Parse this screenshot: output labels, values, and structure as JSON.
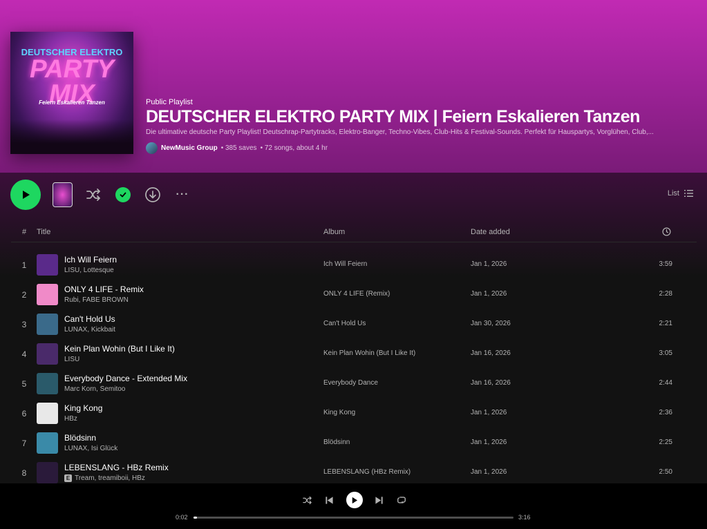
{
  "playlist": {
    "cover_line1": "DEUTSCHER",
    "cover_line1_accent": "ELEKTRO",
    "cover_line2": "PARTY MIX",
    "cover_line3": "Feiern Eskalieren Tanzen",
    "type_label": "Public Playlist",
    "title": "DEUTSCHER ELEKTRO PARTY MIX | Feiern Eskalieren Tanzen",
    "description": "Die ultimative deutsche Party Playlist! Deutschrap-Partytracks, Elektro-Banger, Techno-Vibes, Club-Hits & Festival-Sounds. Perfekt für Hauspartys, Vorglühen, Club,...",
    "owner": "NewMusic Group",
    "saves": "• 385 saves",
    "songs": "• 72 songs, about 4 hr"
  },
  "actions": {
    "view_label": "List",
    "more_label": "···"
  },
  "table": {
    "headers": {
      "num": "#",
      "title": "Title",
      "album": "Album",
      "date": "Date added"
    },
    "tracks": [
      {
        "num": "1",
        "title": "Ich Will Feiern",
        "artist": "LISU, Lottesque",
        "explicit": false,
        "album": "Ich Will Feiern",
        "date": "Jan 1, 2026",
        "duration": "3:59",
        "art_color": "#5a2a8a"
      },
      {
        "num": "2",
        "title": "ONLY 4 LIFE - Remix",
        "artist": "Rubi, FABE BROWN",
        "explicit": false,
        "album": "ONLY 4 LIFE (Remix)",
        "date": "Jan 1, 2026",
        "duration": "2:28",
        "art_color": "#f08ac8"
      },
      {
        "num": "3",
        "title": "Can't Hold Us",
        "artist": "LUNAX, Kickbait",
        "explicit": false,
        "album": "Can't Hold Us",
        "date": "Jan 30, 2026",
        "duration": "2:21",
        "art_color": "#3a6a8a"
      },
      {
        "num": "4",
        "title": "Kein Plan Wohin (But I Like It)",
        "artist": "LISU",
        "explicit": false,
        "album": "Kein Plan Wohin (But I Like It)",
        "date": "Jan 16, 2026",
        "duration": "3:05",
        "art_color": "#4a2a6a"
      },
      {
        "num": "5",
        "title": "Everybody Dance - Extended Mix",
        "artist": "Marc Korn, Semitoo",
        "explicit": false,
        "album": "Everybody Dance",
        "date": "Jan 16, 2026",
        "duration": "2:44",
        "art_color": "#2a5a6a"
      },
      {
        "num": "6",
        "title": "King Kong",
        "artist": "HBz",
        "explicit": false,
        "album": "King Kong",
        "date": "Jan 1, 2026",
        "duration": "2:36",
        "art_color": "#e8e8e8"
      },
      {
        "num": "7",
        "title": "Blödsinn",
        "artist": "LUNAX, Isi Glück",
        "explicit": false,
        "album": "Blödsinn",
        "date": "Jan 1, 2026",
        "duration": "2:25",
        "art_color": "#3a8aa8"
      },
      {
        "num": "8",
        "title": "LEBENSLANG - HBz Remix",
        "artist": "Tream, treamiboii, HBz",
        "explicit": true,
        "album": "LEBENSLANG (HBz Remix)",
        "date": "Jan 1, 2026",
        "duration": "2:50",
        "art_color": "#2a1a3a"
      }
    ]
  },
  "explicit_label": "E",
  "player": {
    "elapsed": "0:02",
    "total": "3:16",
    "progress": 0.01
  },
  "colors": {
    "accent": "#1ed760",
    "header": "#c12ab3"
  }
}
